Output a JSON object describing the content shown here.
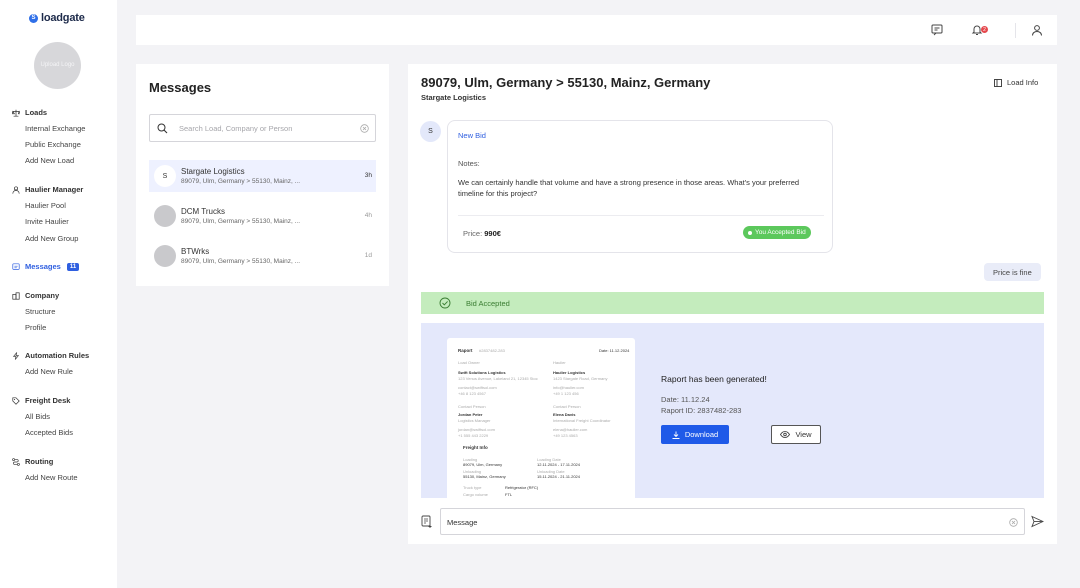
{
  "brand": {
    "name": "loadgate",
    "mark": "S"
  },
  "sidebar": {
    "upload_logo": "Upload Logo",
    "sections": [
      {
        "label": "Loads",
        "icon": "scale-icon",
        "items": [
          "Internal Exchange",
          "Public Exchange",
          "Add New Load"
        ]
      },
      {
        "label": "Haulier Manager",
        "icon": "user-icon",
        "items": [
          "Haulier Pool",
          "Invite Haulier",
          "Add New Group"
        ]
      },
      {
        "label": "Messages",
        "icon": "message-icon",
        "badge": "11",
        "items": []
      },
      {
        "label": "Company",
        "icon": "building-icon",
        "items": [
          "Structure",
          "Profile"
        ]
      },
      {
        "label": "Automation Rules",
        "icon": "bolt-icon",
        "items": [
          "Add New Rule"
        ]
      },
      {
        "label": "Freight Desk",
        "icon": "tag-icon",
        "items": [
          "All Bids",
          "Accepted Bids"
        ]
      },
      {
        "label": "Routing",
        "icon": "route-icon",
        "items": [
          "Add New Route"
        ]
      }
    ]
  },
  "header": {
    "notification_count": "2"
  },
  "messages": {
    "title": "Messages",
    "search_placeholder": "Search Load, Company or Person",
    "conversations": [
      {
        "initial": "S",
        "name": "Stargate Logistics",
        "route": "89079, Ulm, Germany > 55130, Mainz, ...",
        "time": "3h"
      },
      {
        "initial": "",
        "name": "DCM Trucks",
        "route": "89079, Ulm, Germany > 55130, Mainz, ...",
        "time": "4h"
      },
      {
        "initial": "",
        "name": "BTWrks",
        "route": "89079, Ulm, Germany > 55130, Mainz, ...",
        "time": "1d"
      }
    ]
  },
  "chat": {
    "route": "89079, Ulm, Germany > 55130, Mainz, Germany",
    "company": "Stargate Logistics",
    "load_info_label": "Load Info",
    "bid": {
      "avatar": "S",
      "title": "New Bid",
      "notes_label": "Notes:",
      "notes": "We can certainly handle that volume and have a strong presence in those areas. What's your preferred timeline for this project?",
      "price_label": "Price:",
      "price": "990€",
      "status": "You Accepted Bid"
    },
    "reply": "Price is fine",
    "bid_accepted_label": "Bid Accepted",
    "report": {
      "title": "Raport has been generated!",
      "date": "Date: 11.12.24",
      "id": "Raport ID: 2837482-283",
      "download_label": "Download",
      "view_label": "View",
      "preview": {
        "heading": "Raport",
        "sub": "#2837482-283",
        "date": "Date: 11.12.2024",
        "from_label": "Load Owner",
        "from_name": "Swift Solutions Logistics",
        "from_addr": "123 Venus Avenue, Lakeland 21, 12345 Stockholm",
        "from_mail": "contact@swiftsol.com",
        "from_phone": "+46 8 123 4567",
        "to_label": "Haulier",
        "to_name": "Haulier Logistics",
        "to_addr": "1423 Stargate Road, Germany",
        "to_mail": "info@haulier.com",
        "to_phone": "+49 1 123 456",
        "c1_label": "Contact Person",
        "c1_name": "Jordan Peter",
        "c1_role": "Logistics Manager",
        "c1_mail": "jordan@swiftsol.com",
        "c1_phone": "+1 555 443 2229",
        "c2_label": "Contact Person",
        "c2_name": "Elena Davis",
        "c2_role": "International Freight Coordinator",
        "c2_mail": "elena@haulier.com",
        "c2_phone": "+49 123 4563",
        "freight_heading": "Freight Info",
        "loading_label": "Loading",
        "loading": "89079, Ulm, Germany",
        "loading_date_label": "Loading Date",
        "loading_date": "12.11.2024 - 17.11.2024",
        "unloading_label": "Unloading",
        "unloading": "55130, Mainz, Germany",
        "unloading_date_label": "Unloading Date",
        "unloading_date": "15.11.2024 - 21.11.2024",
        "truck_label": "Truck type",
        "truck": "Refrigerator (RFC)",
        "cargo_label": "Cargo volume",
        "cargo": "FTL"
      }
    },
    "input_placeholder": "Message"
  }
}
